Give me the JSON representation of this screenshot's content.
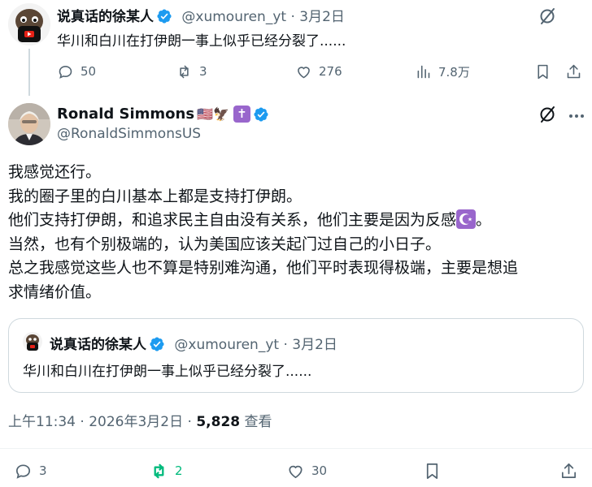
{
  "parent": {
    "name": "说真话的徐某人",
    "handle": "@xumouren_yt",
    "sep": "·",
    "date": "3月2日",
    "text": "华川和白川在打伊朗一事上似乎已经分裂了......",
    "replies": "50",
    "reposts": "3",
    "likes": "276",
    "views": "7.8万"
  },
  "tweet": {
    "name": "Ronald Simmons",
    "name_emojis": "🇺🇸🦅",
    "cross_emoji": "✝",
    "handle": "@RonaldSimmonsUS",
    "lines": [
      "我感觉还行。",
      "我的圈子里的白川基本上都是支持打伊朗。",
      "他们支持打伊朗，和追求民主自由没有关系，他们主要是因为反感",
      "当然，也有个别极端的，认为美国应该关起门过自己的小日子。",
      "总之我感觉这些人也不算是特别难沟通，他们平时表现得极端，主要是想追",
      "求情绪价值。"
    ],
    "line3_tail": "。",
    "time": "上午11:34",
    "date": "2026年3月2日",
    "views_count": "5,828",
    "views_label": "查看",
    "replies": "3",
    "reposts": "2",
    "likes": "30"
  },
  "quote": {
    "name": "说真话的徐某人",
    "handle": "@xumouren_yt",
    "sep": "·",
    "date": "3月2日",
    "text": "华川和白川在打伊朗一事上似乎已经分裂了......"
  },
  "icons": {
    "verified": "verified-badge-icon",
    "reply": "reply-icon",
    "repost": "repost-icon",
    "like": "heart-icon",
    "views": "views-chart-icon",
    "bookmark": "bookmark-icon",
    "share": "share-icon",
    "grok": "grok-icon"
  },
  "colors": {
    "verified": "#1d9bf0",
    "repost_active": "#00ba7c",
    "muted": "#536471",
    "crescent_bg": "#9966cc"
  }
}
